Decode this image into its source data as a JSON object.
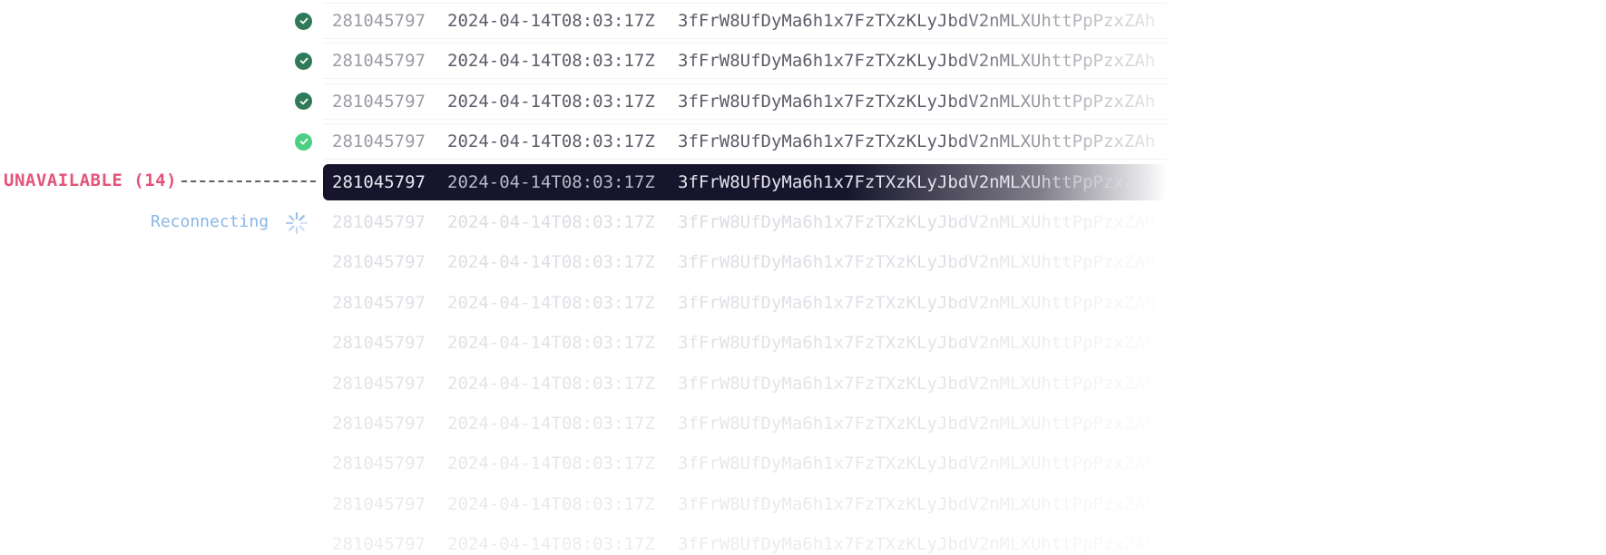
{
  "colors": {
    "success_dark": "#2f7a58",
    "success_light": "#4ccf82",
    "error": "#e35479",
    "reconnecting": "#8ab6e6",
    "active_row_bg": "#17152b"
  },
  "status": {
    "error_label": "UNAVAILABLE (14)",
    "reconnecting_label": "Reconnecting",
    "spinner_icon": "loading-spinner-icon",
    "check_icon": "check-circle-icon"
  },
  "rows": [
    {
      "slot": "281045797",
      "timestamp": "2024-04-14T08:03:17Z",
      "hash": "3fFrW8UfDyMa6h1x7FzTXzKLyJbdV2nMLXUhttPpPzxZAh",
      "state": "confirmed"
    },
    {
      "slot": "281045797",
      "timestamp": "2024-04-14T08:03:17Z",
      "hash": "3fFrW8UfDyMa6h1x7FzTXzKLyJbdV2nMLXUhttPpPzxZAh",
      "state": "confirmed"
    },
    {
      "slot": "281045797",
      "timestamp": "2024-04-14T08:03:17Z",
      "hash": "3fFrW8UfDyMa6h1x7FzTXzKLyJbdV2nMLXUhttPpPzxZAh",
      "state": "confirmed"
    },
    {
      "slot": "281045797",
      "timestamp": "2024-04-14T08:03:17Z",
      "hash": "3fFrW8UfDyMa6h1x7FzTXzKLyJbdV2nMLXUhttPpPzxZAh",
      "state": "processed"
    },
    {
      "slot": "281045797",
      "timestamp": "2024-04-14T08:03:17Z",
      "hash": "3fFrW8UfDyMa6h1x7FzTXzKLyJbdV2nMLXUhttPpPzxZAh",
      "state": "error"
    },
    {
      "slot": "281045797",
      "timestamp": "2024-04-14T08:03:17Z",
      "hash": "3fFrW8UfDyMa6h1x7FzTXzKLyJbdV2nMLXUhttPpPzxZAh",
      "state": "pending"
    },
    {
      "slot": "281045797",
      "timestamp": "2024-04-14T08:03:17Z",
      "hash": "3fFrW8UfDyMa6h1x7FzTXzKLyJbdV2nMLXUhttPpPzxZAh",
      "state": "pending"
    },
    {
      "slot": "281045797",
      "timestamp": "2024-04-14T08:03:17Z",
      "hash": "3fFrW8UfDyMa6h1x7FzTXzKLyJbdV2nMLXUhttPpPzxZAh",
      "state": "pending"
    },
    {
      "slot": "281045797",
      "timestamp": "2024-04-14T08:03:17Z",
      "hash": "3fFrW8UfDyMa6h1x7FzTXzKLyJbdV2nMLXUhttPpPzxZAh",
      "state": "pending"
    },
    {
      "slot": "281045797",
      "timestamp": "2024-04-14T08:03:17Z",
      "hash": "3fFrW8UfDyMa6h1x7FzTXzKLyJbdV2nMLXUhttPpPzxZAh",
      "state": "pending"
    },
    {
      "slot": "281045797",
      "timestamp": "2024-04-14T08:03:17Z",
      "hash": "3fFrW8UfDyMa6h1x7FzTXzKLyJbdV2nMLXUhttPpPzxZAh",
      "state": "pending"
    },
    {
      "slot": "281045797",
      "timestamp": "2024-04-14T08:03:17Z",
      "hash": "3fFrW8UfDyMa6h1x7FzTXzKLyJbdV2nMLXUhttPpPzxZAh",
      "state": "pending"
    },
    {
      "slot": "281045797",
      "timestamp": "2024-04-14T08:03:17Z",
      "hash": "3fFrW8UfDyMa6h1x7FzTXzKLyJbdV2nMLXUhttPpPzxZAh",
      "state": "pending"
    },
    {
      "slot": "281045797",
      "timestamp": "2024-04-14T08:03:17Z",
      "hash": "3fFrW8UfDyMa6h1x7FzTXzKLyJbdV2nMLXUhttPpPzxZAh",
      "state": "pending"
    }
  ]
}
